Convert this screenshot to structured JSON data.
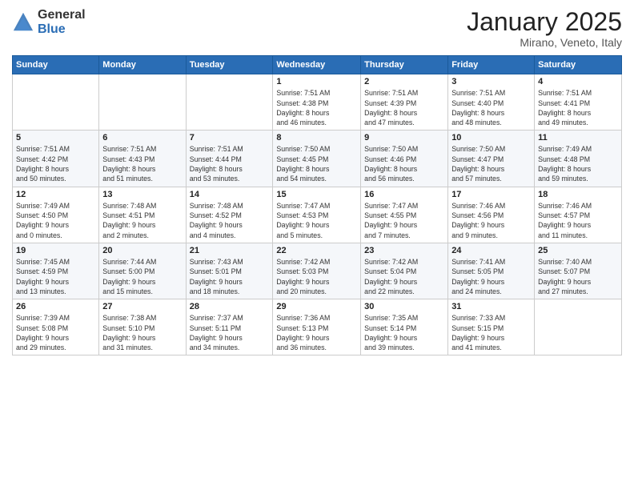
{
  "header": {
    "logo_general": "General",
    "logo_blue": "Blue",
    "month_title": "January 2025",
    "location": "Mirano, Veneto, Italy"
  },
  "weekdays": [
    "Sunday",
    "Monday",
    "Tuesday",
    "Wednesday",
    "Thursday",
    "Friday",
    "Saturday"
  ],
  "weeks": [
    [
      {
        "day": "",
        "info": ""
      },
      {
        "day": "",
        "info": ""
      },
      {
        "day": "",
        "info": ""
      },
      {
        "day": "1",
        "info": "Sunrise: 7:51 AM\nSunset: 4:38 PM\nDaylight: 8 hours\nand 46 minutes."
      },
      {
        "day": "2",
        "info": "Sunrise: 7:51 AM\nSunset: 4:39 PM\nDaylight: 8 hours\nand 47 minutes."
      },
      {
        "day": "3",
        "info": "Sunrise: 7:51 AM\nSunset: 4:40 PM\nDaylight: 8 hours\nand 48 minutes."
      },
      {
        "day": "4",
        "info": "Sunrise: 7:51 AM\nSunset: 4:41 PM\nDaylight: 8 hours\nand 49 minutes."
      }
    ],
    [
      {
        "day": "5",
        "info": "Sunrise: 7:51 AM\nSunset: 4:42 PM\nDaylight: 8 hours\nand 50 minutes."
      },
      {
        "day": "6",
        "info": "Sunrise: 7:51 AM\nSunset: 4:43 PM\nDaylight: 8 hours\nand 51 minutes."
      },
      {
        "day": "7",
        "info": "Sunrise: 7:51 AM\nSunset: 4:44 PM\nDaylight: 8 hours\nand 53 minutes."
      },
      {
        "day": "8",
        "info": "Sunrise: 7:50 AM\nSunset: 4:45 PM\nDaylight: 8 hours\nand 54 minutes."
      },
      {
        "day": "9",
        "info": "Sunrise: 7:50 AM\nSunset: 4:46 PM\nDaylight: 8 hours\nand 56 minutes."
      },
      {
        "day": "10",
        "info": "Sunrise: 7:50 AM\nSunset: 4:47 PM\nDaylight: 8 hours\nand 57 minutes."
      },
      {
        "day": "11",
        "info": "Sunrise: 7:49 AM\nSunset: 4:48 PM\nDaylight: 8 hours\nand 59 minutes."
      }
    ],
    [
      {
        "day": "12",
        "info": "Sunrise: 7:49 AM\nSunset: 4:50 PM\nDaylight: 9 hours\nand 0 minutes."
      },
      {
        "day": "13",
        "info": "Sunrise: 7:48 AM\nSunset: 4:51 PM\nDaylight: 9 hours\nand 2 minutes."
      },
      {
        "day": "14",
        "info": "Sunrise: 7:48 AM\nSunset: 4:52 PM\nDaylight: 9 hours\nand 4 minutes."
      },
      {
        "day": "15",
        "info": "Sunrise: 7:47 AM\nSunset: 4:53 PM\nDaylight: 9 hours\nand 5 minutes."
      },
      {
        "day": "16",
        "info": "Sunrise: 7:47 AM\nSunset: 4:55 PM\nDaylight: 9 hours\nand 7 minutes."
      },
      {
        "day": "17",
        "info": "Sunrise: 7:46 AM\nSunset: 4:56 PM\nDaylight: 9 hours\nand 9 minutes."
      },
      {
        "day": "18",
        "info": "Sunrise: 7:46 AM\nSunset: 4:57 PM\nDaylight: 9 hours\nand 11 minutes."
      }
    ],
    [
      {
        "day": "19",
        "info": "Sunrise: 7:45 AM\nSunset: 4:59 PM\nDaylight: 9 hours\nand 13 minutes."
      },
      {
        "day": "20",
        "info": "Sunrise: 7:44 AM\nSunset: 5:00 PM\nDaylight: 9 hours\nand 15 minutes."
      },
      {
        "day": "21",
        "info": "Sunrise: 7:43 AM\nSunset: 5:01 PM\nDaylight: 9 hours\nand 18 minutes."
      },
      {
        "day": "22",
        "info": "Sunrise: 7:42 AM\nSunset: 5:03 PM\nDaylight: 9 hours\nand 20 minutes."
      },
      {
        "day": "23",
        "info": "Sunrise: 7:42 AM\nSunset: 5:04 PM\nDaylight: 9 hours\nand 22 minutes."
      },
      {
        "day": "24",
        "info": "Sunrise: 7:41 AM\nSunset: 5:05 PM\nDaylight: 9 hours\nand 24 minutes."
      },
      {
        "day": "25",
        "info": "Sunrise: 7:40 AM\nSunset: 5:07 PM\nDaylight: 9 hours\nand 27 minutes."
      }
    ],
    [
      {
        "day": "26",
        "info": "Sunrise: 7:39 AM\nSunset: 5:08 PM\nDaylight: 9 hours\nand 29 minutes."
      },
      {
        "day": "27",
        "info": "Sunrise: 7:38 AM\nSunset: 5:10 PM\nDaylight: 9 hours\nand 31 minutes."
      },
      {
        "day": "28",
        "info": "Sunrise: 7:37 AM\nSunset: 5:11 PM\nDaylight: 9 hours\nand 34 minutes."
      },
      {
        "day": "29",
        "info": "Sunrise: 7:36 AM\nSunset: 5:13 PM\nDaylight: 9 hours\nand 36 minutes."
      },
      {
        "day": "30",
        "info": "Sunrise: 7:35 AM\nSunset: 5:14 PM\nDaylight: 9 hours\nand 39 minutes."
      },
      {
        "day": "31",
        "info": "Sunrise: 7:33 AM\nSunset: 5:15 PM\nDaylight: 9 hours\nand 41 minutes."
      },
      {
        "day": "",
        "info": ""
      }
    ]
  ]
}
